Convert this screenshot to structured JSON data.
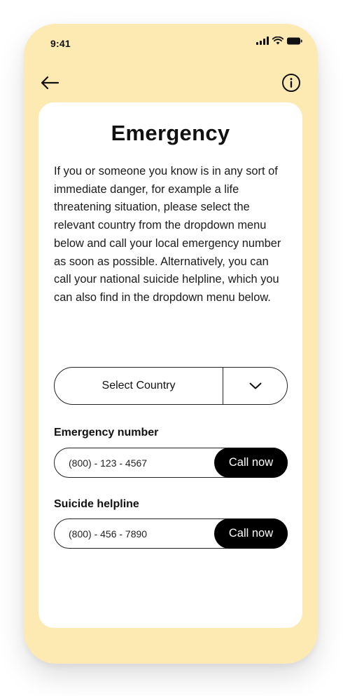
{
  "status_bar": {
    "time": "9:41",
    "icons": [
      "signal-icon",
      "wifi-icon",
      "battery-icon"
    ]
  },
  "header": {
    "back_icon": "arrow-left-icon",
    "info_icon": "info-circle-icon"
  },
  "card": {
    "title": "Emergency",
    "body": "If you or someone you know is in any sort of immediate danger, for example a life threatening situation, please select the relevant country from the dropdown menu below and call your local emergency number as soon as possible. Alternatively, you can call your national suicide helpline, which you can also find in the dropdown menu below."
  },
  "country_select": {
    "label": "Select Country",
    "toggle_icon": "chevron-down-icon"
  },
  "emergency": {
    "label": "Emergency number",
    "number": "(800) - 123 - 4567",
    "button_label": "Call now"
  },
  "helpline": {
    "label": "Suicide helpline",
    "number": "(800) - 456 - 7890",
    "button_label": "Call now"
  },
  "colors": {
    "phone_background": "#fde9b2",
    "card_background": "#ffffff",
    "button_background": "#000000",
    "button_text": "#ffffff",
    "text": "#111111"
  }
}
